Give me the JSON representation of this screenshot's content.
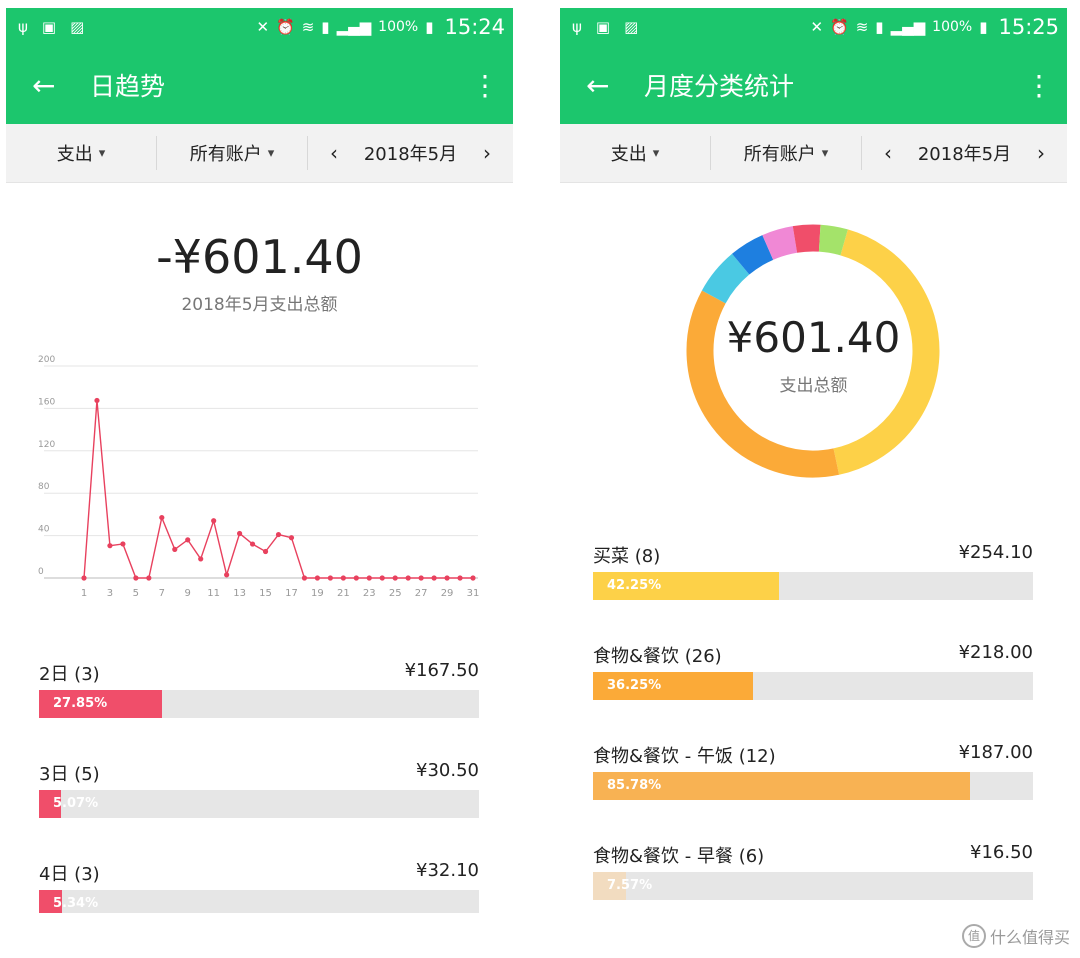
{
  "left": {
    "status": {
      "percent": "100%",
      "time": "15:24"
    },
    "title": "日趋势",
    "filters": {
      "type": "支出",
      "account": "所有账户",
      "month": "2018年5月"
    },
    "total": "-¥601.40",
    "total_label": "2018年5月支出总额",
    "chart_data": {
      "type": "line",
      "title": "",
      "xlabel": "",
      "ylabel": "",
      "x": [
        1,
        2,
        3,
        4,
        5,
        6,
        7,
        8,
        9,
        10,
        11,
        12,
        13,
        14,
        15,
        16,
        17,
        18,
        19,
        20,
        21,
        22,
        23,
        24,
        25,
        26,
        27,
        28,
        29,
        30,
        31
      ],
      "values": [
        0,
        167.5,
        30.5,
        32.1,
        0,
        0,
        57,
        27,
        36,
        18,
        54,
        3,
        42,
        32,
        25,
        41,
        38,
        0,
        0,
        0,
        0,
        0,
        0,
        0,
        0,
        0,
        0,
        0,
        0,
        0,
        0
      ],
      "x_tick_labels": [
        "1",
        "3",
        "5",
        "7",
        "9",
        "11",
        "13",
        "15",
        "17",
        "19",
        "21",
        "23",
        "25",
        "27",
        "29",
        "31"
      ],
      "y_tick_labels": [
        "0",
        "40",
        "80",
        "120",
        "160",
        "200"
      ],
      "ylim": [
        0,
        200
      ],
      "grid": true,
      "color": "#e8415e"
    },
    "rows": [
      {
        "label": "2日 (3)",
        "amount": "¥167.50",
        "pct": "27.85%",
        "fraction": 0.2785,
        "color": "#f04e6a"
      },
      {
        "label": "3日 (5)",
        "amount": "¥30.50",
        "pct": "5.07%",
        "fraction": 0.0507,
        "color": "#f04e6a"
      },
      {
        "label": "4日 (3)",
        "amount": "¥32.10",
        "pct": "5.34%",
        "fraction": 0.0534,
        "color": "#f04e6a"
      }
    ]
  },
  "right": {
    "status": {
      "percent": "100%",
      "time": "15:25"
    },
    "title": "月度分类统计",
    "filters": {
      "type": "支出",
      "account": "所有账户",
      "month": "2018年5月"
    },
    "donut_total": "¥601.40",
    "donut_label": "支出总额",
    "chart_data": {
      "type": "pie",
      "style": "donut",
      "slices": [
        {
          "value": 42.25,
          "color": "#fdd148"
        },
        {
          "value": 36.25,
          "color": "#fbaa38"
        },
        {
          "value": 6.0,
          "color": "#4ac9e3"
        },
        {
          "value": 4.5,
          "color": "#1e7fe0"
        },
        {
          "value": 4.0,
          "color": "#f088d5"
        },
        {
          "value": 3.5,
          "color": "#f04e6a"
        },
        {
          "value": 3.5,
          "color": "#a4e36a"
        }
      ]
    },
    "rows": [
      {
        "label": "买菜 (8)",
        "amount": "¥254.10",
        "pct": "42.25%",
        "fraction": 0.4225,
        "color": "#fdd148"
      },
      {
        "label": "食物&餐饮 (26)",
        "amount": "¥218.00",
        "pct": "36.25%",
        "fraction": 0.3625,
        "color": "#fbaa38"
      },
      {
        "label": "食物&餐饮 - 午饭 (12)",
        "amount": "¥187.00",
        "pct": "85.78%",
        "fraction": 0.8578,
        "color": "#f8b253"
      },
      {
        "label": "食物&餐饮 - 早餐 (6)",
        "amount": "¥16.50",
        "pct": "7.57%",
        "fraction": 0.0757,
        "color": "#f2dcc0"
      }
    ]
  },
  "watermark": "什么值得买",
  "watermark_logo": "值"
}
